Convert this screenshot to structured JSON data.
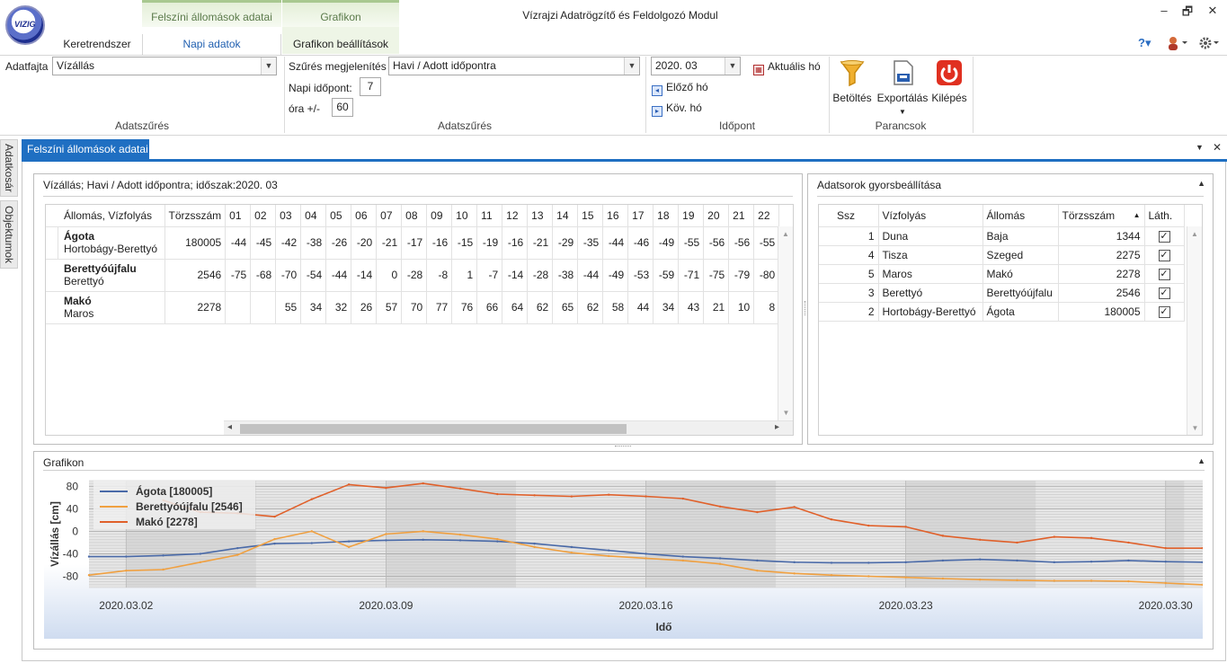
{
  "app": {
    "title": "Vízrajzi Adatrögzítő és Feldolgozó Modul",
    "tabs": [
      {
        "label": "Keretrendszer"
      },
      {
        "label": "Napi adatok",
        "active": true
      },
      {
        "label": "Grafikon beállítások"
      }
    ],
    "context_tabs": [
      {
        "label": "Felszíni állomások adatai"
      },
      {
        "label": "Grafikon"
      }
    ],
    "window_controls": {
      "min": "–",
      "max": "🗗",
      "close": "✕"
    },
    "right_icons": [
      "help-icon",
      "user-icon",
      "settings-icon"
    ]
  },
  "ribbon": {
    "adatfajta_label": "Adatfajta",
    "adatfajta_value": "Vízállás",
    "group1_label": "Adatszűrés",
    "szures_label": "Szűrés megjelenítés",
    "szures_value": "Havi / Adott időpontra",
    "napi_label": "Napi időpont:",
    "napi_value": "7",
    "ora_label": "óra +/-",
    "ora_value": "60",
    "group2_label": "Adatszűrés",
    "period_value": "2020. 03",
    "aktualis_label": "Aktuális hó",
    "elozo_label": "Előző hó",
    "kov_label": "Köv. hó",
    "group3_label": "Időpont",
    "betoltes_label": "Betöltés",
    "export_label": "Exportálás",
    "kilepes_label": "Kilépés",
    "group4_label": "Parancsok"
  },
  "sidebar": {
    "items": [
      "Adatkosár",
      "Objektumok"
    ]
  },
  "doc_tab": {
    "label": "Felszíni állomások adatai"
  },
  "data_panel": {
    "title": "Vízállás; Havi / Adott időpontra; időszak:2020. 03",
    "headers": [
      "Állomás, Vízfolyás",
      "Törzsszám",
      "01",
      "02",
      "03",
      "04",
      "05",
      "06",
      "07",
      "08",
      "09",
      "10",
      "11",
      "12",
      "13",
      "14",
      "15",
      "16",
      "17",
      "18",
      "19",
      "20",
      "21",
      "22"
    ],
    "rows": [
      {
        "station": "Ágota",
        "river": "Hortobágy-Berettyó",
        "id": "180005",
        "values": [
          "-44",
          "-45",
          "-42",
          "-38",
          "-26",
          "-20",
          "-21",
          "-17",
          "-16",
          "-15",
          "-19",
          "-16",
          "-21",
          "-29",
          "-35",
          "-44",
          "-46",
          "-49",
          "-55",
          "-56",
          "-56",
          "-55"
        ]
      },
      {
        "station": "Berettyóújfalu",
        "river": "Berettyó",
        "id": "2546",
        "values": [
          "-75",
          "-68",
          "-70",
          "-54",
          "-44",
          "-14",
          "0",
          "-28",
          "-8",
          "1",
          "-7",
          "-14",
          "-28",
          "-38",
          "-44",
          "-49",
          "-53",
          "-59",
          "-71",
          "-75",
          "-79",
          "-80"
        ]
      },
      {
        "station": "Makó",
        "river": "Maros",
        "id": "2278",
        "values": [
          "",
          "",
          "55",
          "34",
          "32",
          "26",
          "57",
          "70",
          "77",
          "76",
          "66",
          "64",
          "62",
          "65",
          "62",
          "58",
          "44",
          "34",
          "43",
          "21",
          "10",
          "8"
        ]
      }
    ]
  },
  "series_panel": {
    "title": "Adatsorok gyorsbeállítása",
    "headers": [
      "Ssz",
      "Vízfolyás",
      "Állomás",
      "Törzsszám",
      "Láth."
    ],
    "rows": [
      {
        "ssz": "1",
        "river": "Duna",
        "station": "Baja",
        "id": "1344",
        "visible": "✓"
      },
      {
        "ssz": "4",
        "river": "Tisza",
        "station": "Szeged",
        "id": "2275",
        "visible": "✓"
      },
      {
        "ssz": "5",
        "river": "Maros",
        "station": "Makó",
        "id": "2278",
        "visible": "✓"
      },
      {
        "ssz": "3",
        "river": "Berettyó",
        "station": "Berettyóújfalu",
        "id": "2546",
        "visible": "✓"
      },
      {
        "ssz": "2",
        "river": "Hortobágy-Berettyó",
        "station": "Ágota",
        "id": "180005",
        "visible": "✓"
      }
    ]
  },
  "chart_panel": {
    "title": "Grafikon"
  },
  "chart_data": {
    "type": "line",
    "title": "",
    "xlabel": "Idő",
    "ylabel": "Vízállás [cm]",
    "ylim": [
      -100,
      90
    ],
    "yticks": [
      80,
      40,
      0,
      -40,
      -80
    ],
    "xlim": [
      "2020.03.01",
      "2020.03.31"
    ],
    "xticks": [
      "2020.03.02",
      "2020.03.09",
      "2020.03.16",
      "2020.03.23",
      "2020.03.30"
    ],
    "legend_position": "top-left",
    "series": [
      {
        "name": "Ágota [180005]",
        "color": "#4a6aa8",
        "x": [
          "2020.03.01",
          "2020.03.02",
          "2020.03.03",
          "2020.03.04",
          "2020.03.05",
          "2020.03.06",
          "2020.03.07",
          "2020.03.08",
          "2020.03.09",
          "2020.03.10",
          "2020.03.11",
          "2020.03.12",
          "2020.03.13",
          "2020.03.14",
          "2020.03.15",
          "2020.03.16",
          "2020.03.17",
          "2020.03.18",
          "2020.03.19",
          "2020.03.20",
          "2020.03.21",
          "2020.03.22",
          "2020.03.23",
          "2020.03.24",
          "2020.03.25",
          "2020.03.26",
          "2020.03.27",
          "2020.03.28",
          "2020.03.29",
          "2020.03.30",
          "2020.03.31"
        ],
        "values": [
          -45,
          -45,
          -43,
          -40,
          -30,
          -22,
          -21,
          -18,
          -16,
          -15,
          -16,
          -18,
          -22,
          -28,
          -34,
          -40,
          -45,
          -48,
          -52,
          -55,
          -56,
          -56,
          -55,
          -52,
          -50,
          -52,
          -55,
          -54,
          -52,
          -54,
          -55
        ]
      },
      {
        "name": "Berettyóújfalu [2546]",
        "color": "#f0a040",
        "x": [
          "2020.03.01",
          "2020.03.02",
          "2020.03.03",
          "2020.03.04",
          "2020.03.05",
          "2020.03.06",
          "2020.03.07",
          "2020.03.08",
          "2020.03.09",
          "2020.03.10",
          "2020.03.11",
          "2020.03.12",
          "2020.03.13",
          "2020.03.14",
          "2020.03.15",
          "2020.03.16",
          "2020.03.17",
          "2020.03.18",
          "2020.03.19",
          "2020.03.20",
          "2020.03.21",
          "2020.03.22",
          "2020.03.23",
          "2020.03.24",
          "2020.03.25",
          "2020.03.26",
          "2020.03.27",
          "2020.03.28",
          "2020.03.29",
          "2020.03.30",
          "2020.03.31"
        ],
        "values": [
          -78,
          -70,
          -68,
          -55,
          -42,
          -14,
          0,
          -28,
          -5,
          0,
          -6,
          -14,
          -28,
          -38,
          -44,
          -48,
          -52,
          -58,
          -70,
          -75,
          -78,
          -80,
          -82,
          -84,
          -86,
          -87,
          -88,
          -88,
          -89,
          -92,
          -95
        ]
      },
      {
        "name": "Makó [2278]",
        "color": "#e0602a",
        "x": [
          "2020.03.03",
          "2020.03.04",
          "2020.03.05",
          "2020.03.06",
          "2020.03.07",
          "2020.03.08",
          "2020.03.09",
          "2020.03.10",
          "2020.03.11",
          "2020.03.12",
          "2020.03.13",
          "2020.03.14",
          "2020.03.15",
          "2020.03.16",
          "2020.03.17",
          "2020.03.18",
          "2020.03.19",
          "2020.03.20",
          "2020.03.21",
          "2020.03.22",
          "2020.03.23",
          "2020.03.24",
          "2020.03.25",
          "2020.03.26",
          "2020.03.27",
          "2020.03.28",
          "2020.03.29",
          "2020.03.30",
          "2020.03.31"
        ],
        "values": [
          55,
          34,
          32,
          26,
          57,
          83,
          77,
          85,
          76,
          66,
          64,
          62,
          65,
          62,
          58,
          44,
          34,
          43,
          21,
          10,
          8,
          -8,
          -15,
          -20,
          -10,
          -12,
          -20,
          -30,
          -30
        ]
      }
    ]
  }
}
